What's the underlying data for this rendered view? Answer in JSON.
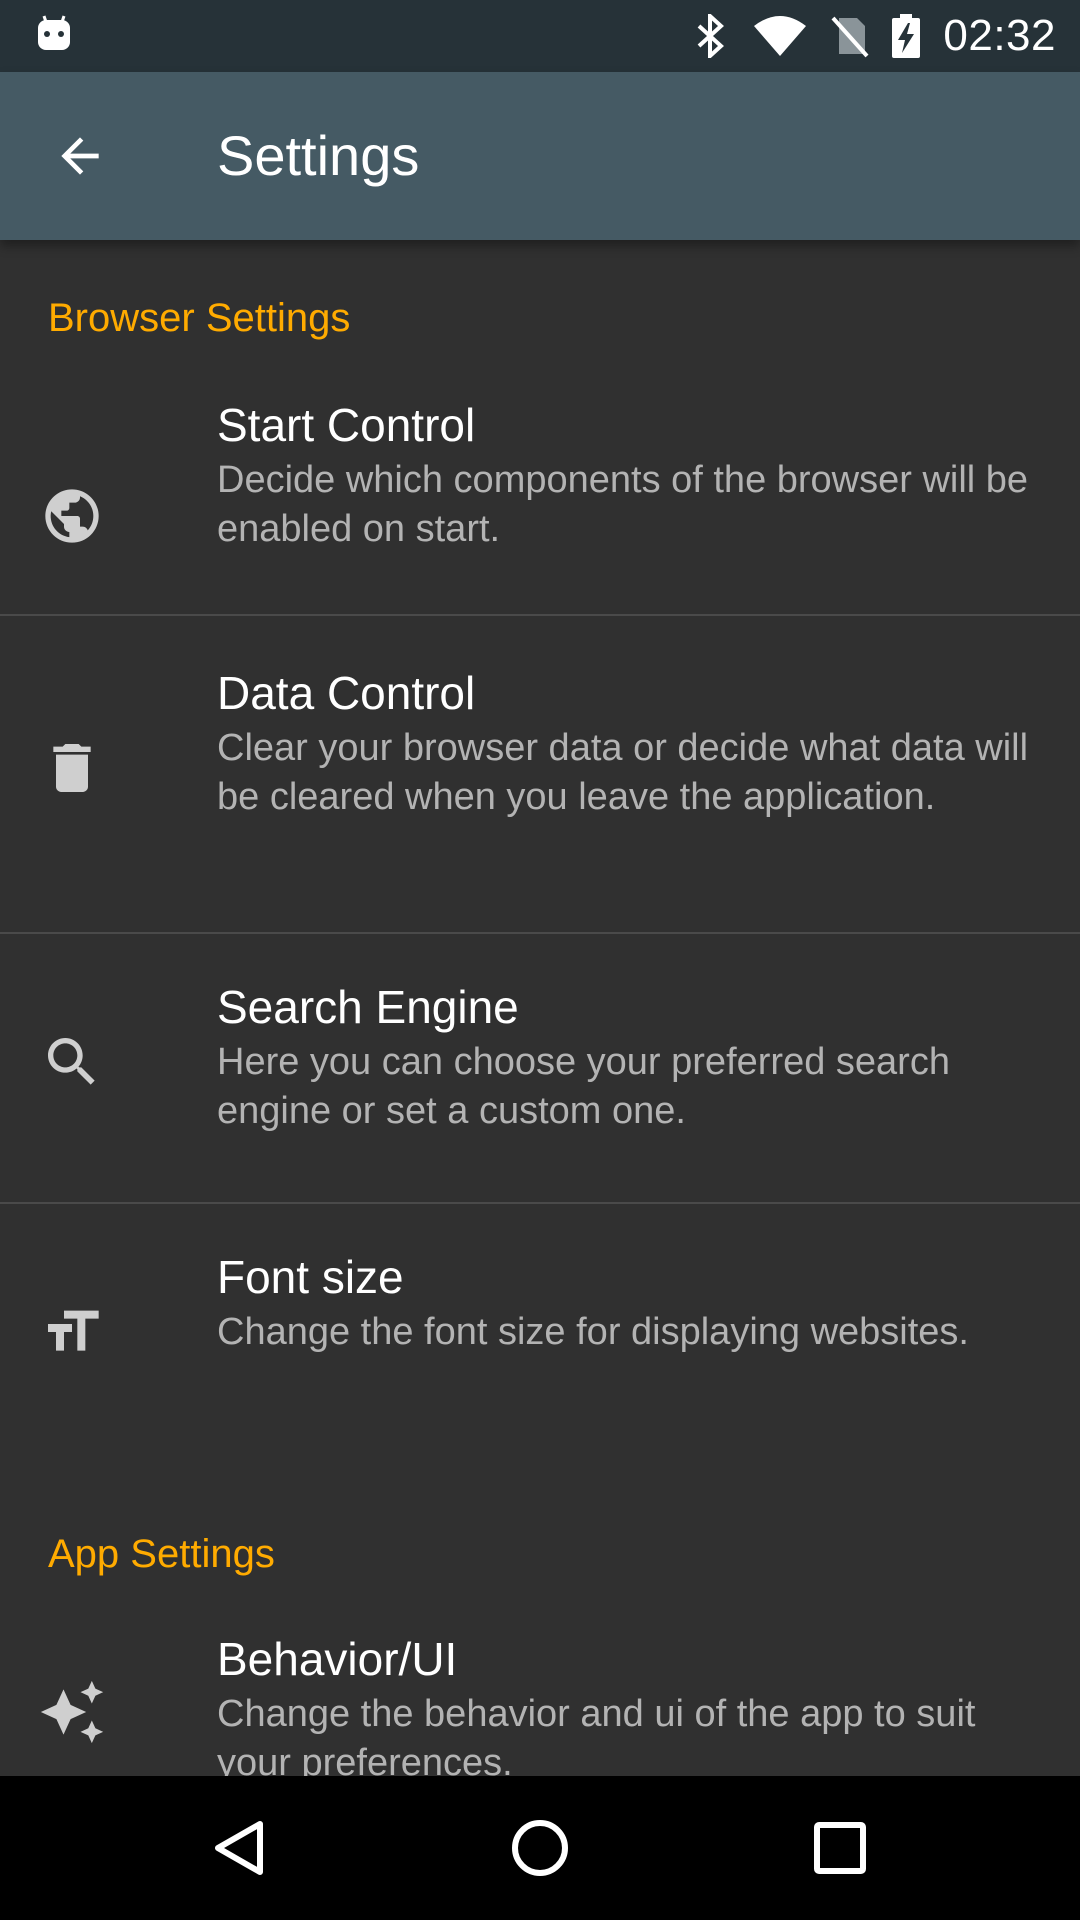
{
  "status_bar": {
    "time": "02:32",
    "icons": [
      "android-debug-icon",
      "bluetooth-icon",
      "wifi-icon",
      "no-sim-icon",
      "battery-charging-icon"
    ]
  },
  "toolbar": {
    "title": "Settings",
    "back_icon": "arrow-back-icon"
  },
  "sections": {
    "browser": {
      "header": "Browser Settings",
      "items": [
        {
          "icon": "globe-icon",
          "title": "Start Control",
          "summary": "Decide which components of the browser will be enabled on start."
        },
        {
          "icon": "trash-icon",
          "title": "Data Control",
          "summary": "Clear your browser data or decide what data will be cleared when you leave the application."
        },
        {
          "icon": "search-icon",
          "title": "Search Engine",
          "summary": "Here you can choose your preferred search engine or set a custom one."
        },
        {
          "icon": "text-size-icon",
          "title": "Font size",
          "summary": "Change the font size for displaying websites."
        }
      ]
    },
    "app": {
      "header": "App Settings",
      "items": [
        {
          "icon": "sparkle-icon",
          "title": "Behavior/UI",
          "summary": "Change the behavior and ui of the app to suit your preferences."
        }
      ]
    }
  },
  "nav_bar": {
    "buttons": [
      "back-nav-icon",
      "home-nav-icon",
      "recents-nav-icon"
    ]
  },
  "colors": {
    "status_bar": "#263238",
    "toolbar": "#455a64",
    "background": "#303030",
    "accent": "#ffab00"
  }
}
